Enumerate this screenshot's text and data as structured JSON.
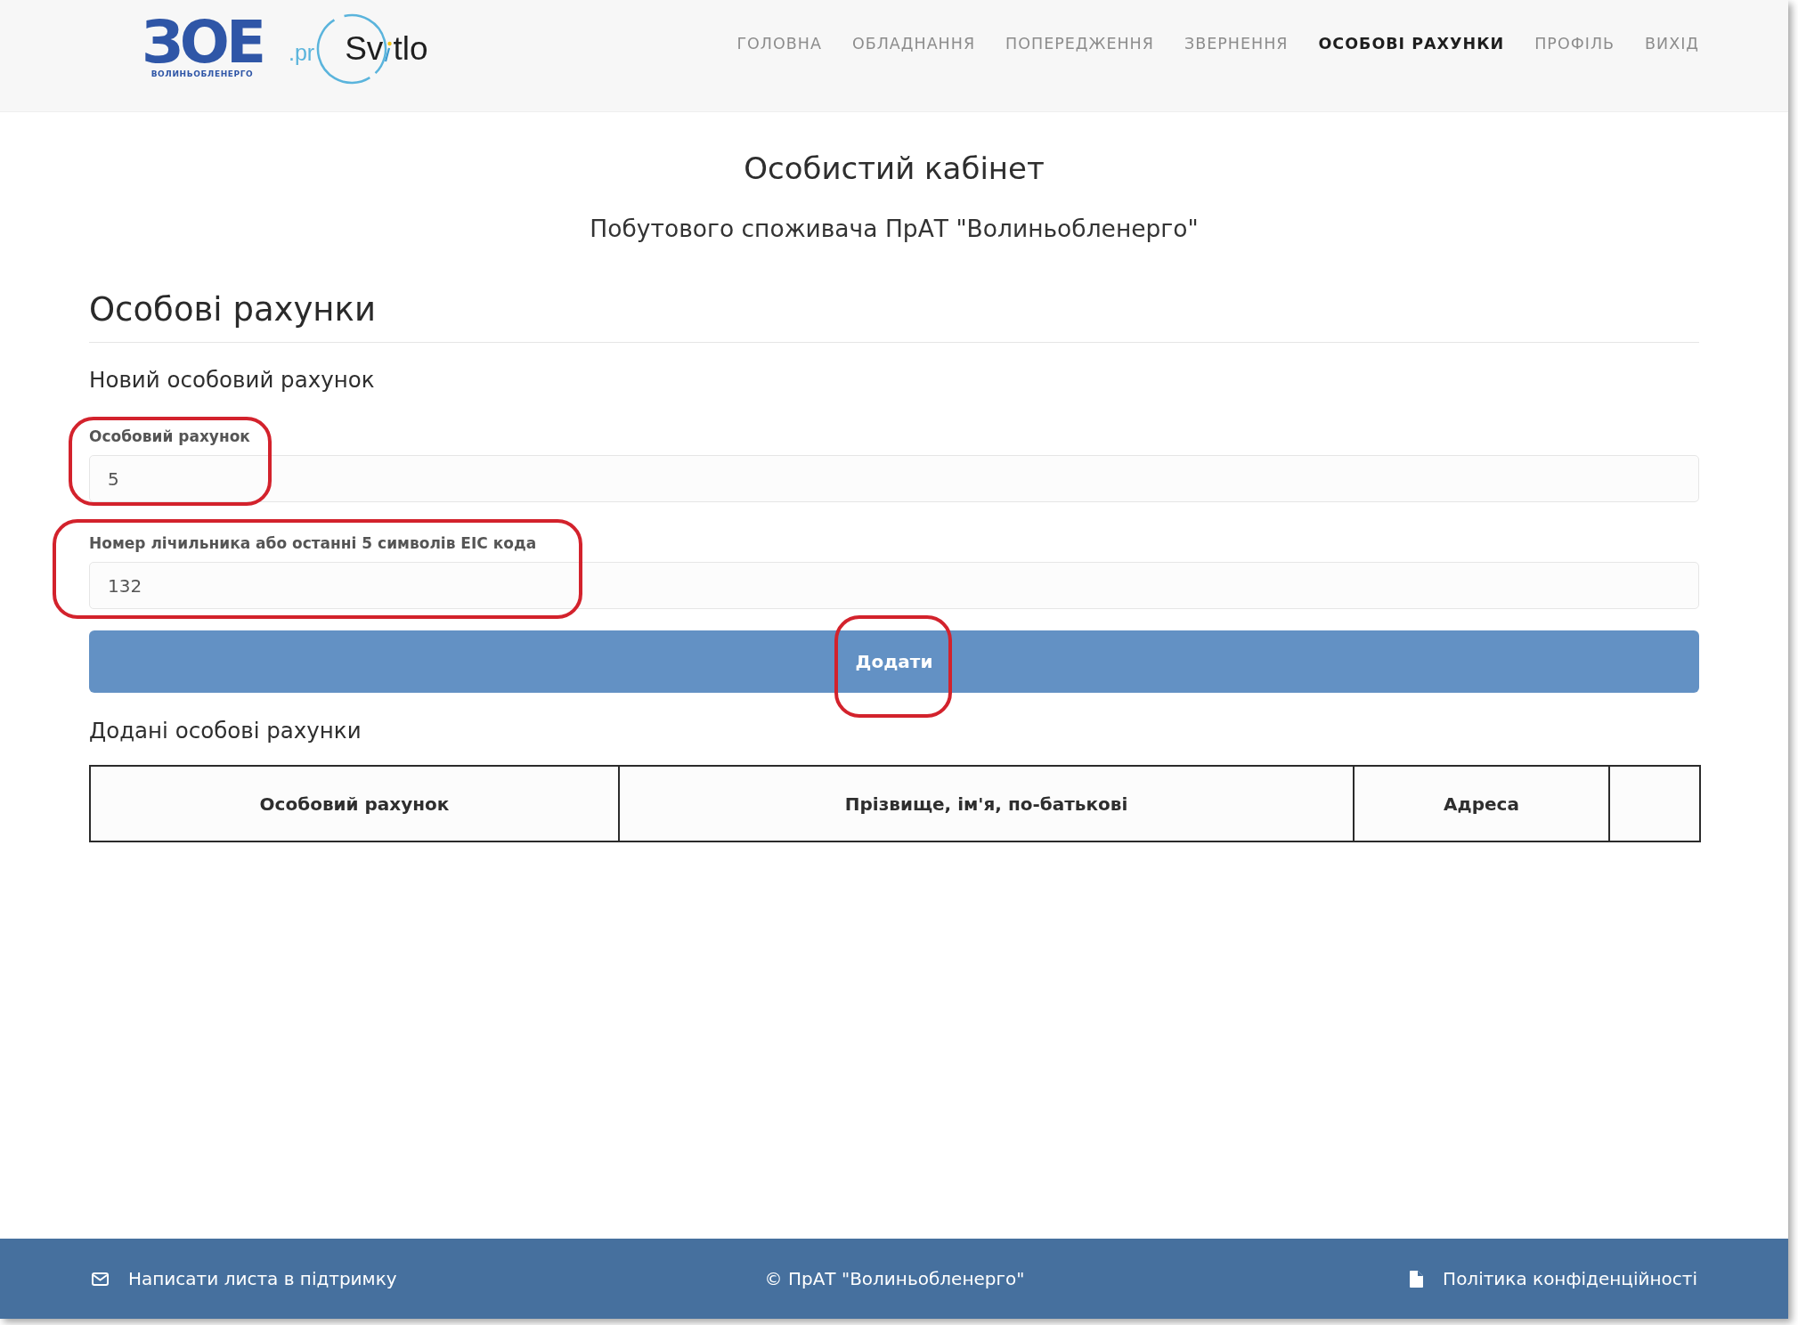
{
  "header": {
    "logo": {
      "mark": "ЗОЕ",
      "caption": "ВОЛИНЬОБЛЕНЕРГО"
    },
    "svitlo_logo": {
      "prefix": ".pr",
      "word_start": "Sv",
      "word_end": "tlo"
    },
    "nav": [
      {
        "label": "ГОЛОВНА",
        "selected": false
      },
      {
        "label": "ОБЛАДНАННЯ",
        "selected": false
      },
      {
        "label": "ПОПЕРЕДЖЕННЯ",
        "selected": false
      },
      {
        "label": "ЗВЕРНЕННЯ",
        "selected": false
      },
      {
        "label": "ОСОБОВІ РАХУНКИ",
        "selected": true
      },
      {
        "label": "ПРОФІЛЬ",
        "selected": false
      },
      {
        "label": "ВИХІД",
        "selected": false
      }
    ]
  },
  "page": {
    "title": "Особистий кабінет",
    "subtitle": "Побутового споживача ПрАТ \"Волиньобленерго\""
  },
  "section": {
    "heading": "Особові рахунки",
    "form_heading": "Новий особовий рахунок",
    "fields": [
      {
        "label": "Особовий рахунок",
        "value": "5",
        "circled": true
      },
      {
        "label": "Номер лічильника або останні 5 символів EIC кода",
        "value": "132",
        "circled": true
      }
    ],
    "add_button": {
      "label": "Додати",
      "circled": true
    },
    "table_heading": "Додані особові рахунки",
    "table": {
      "columns": [
        "Особовий рахунок",
        "Прізвище, ім'я, по-батькові",
        "Адреса"
      ],
      "trailing_empty_column": true
    }
  },
  "footer": {
    "support_link": "Написати листа в підтримку",
    "copyright": "© ПрАТ \"Волиньобленерго\"",
    "privacy_link": "Політика конфіденційності"
  }
}
